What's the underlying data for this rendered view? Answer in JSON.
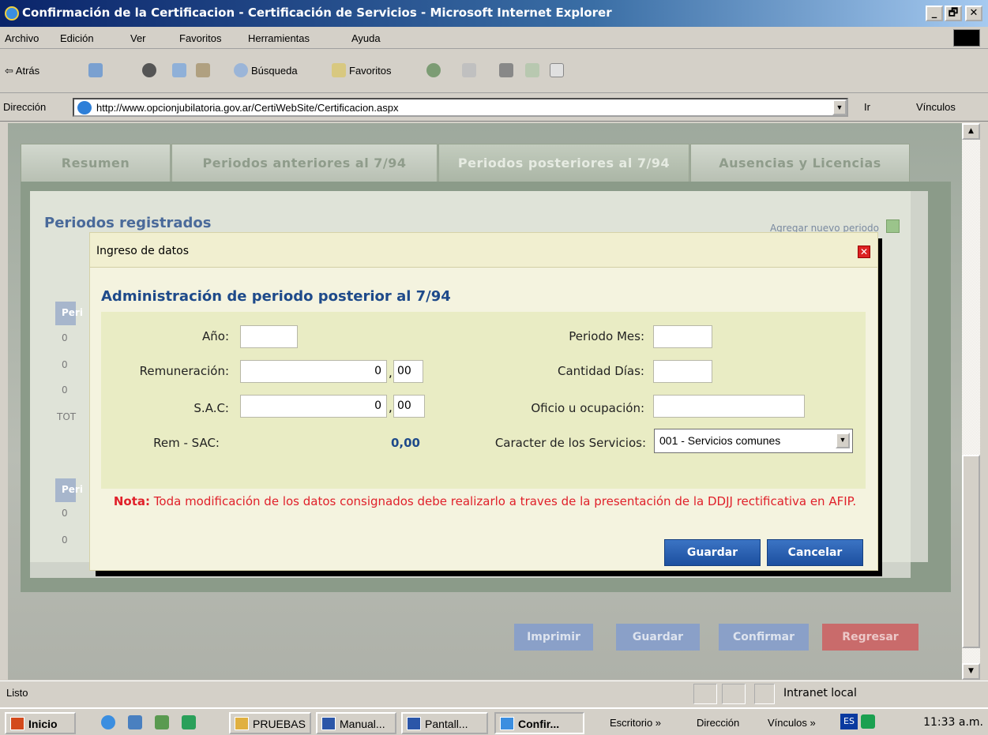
{
  "window": {
    "title": "Confirmación de la Certificacion - Certificación de Servicios - Microsoft Internet Explorer",
    "min": "_",
    "max": "🗗",
    "close": "✕"
  },
  "menu": [
    "Archivo",
    "Edición",
    "Ver",
    "Favoritos",
    "Herramientas",
    "Ayuda"
  ],
  "toolbar": {
    "back": "⇦ Atrás",
    "search": "Búsqueda",
    "favorites": "Favoritos"
  },
  "address": {
    "label": "Dirección",
    "url": "http://www.opcionjubilatoria.gov.ar/CertiWebSite/Certificacion.aspx",
    "go": "Ir",
    "links": "Vínculos"
  },
  "tabs": [
    "Resumen",
    "Periodos anteriores al 7/94",
    "Periodos posteriores al 7/94",
    "Ausencias y Licencias"
  ],
  "section": {
    "title": "Periodos registrados",
    "add": "Agregar nuevo periodo"
  },
  "grid_stub": [
    "Peri",
    "0",
    "0",
    "0",
    "TOT",
    "Peri",
    "0",
    "0"
  ],
  "page_buttons": [
    "Imprimir",
    "Guardar",
    "Confirmar",
    "Regresar"
  ],
  "modal": {
    "title": "Ingreso de datos",
    "close": "✕",
    "heading": "Administración de periodo posterior al 7/94",
    "fields": {
      "anio": {
        "label": "Año:",
        "value": ""
      },
      "remuneracion": {
        "label": "Remuneración:",
        "int": "0",
        "dec": "00"
      },
      "sac": {
        "label": "S.A.C:",
        "int": "0",
        "dec": "00"
      },
      "rem_sac": {
        "label": "Rem - SAC:",
        "value": "0,00"
      },
      "mes": {
        "label": "Periodo Mes:",
        "value": ""
      },
      "dias": {
        "label": "Cantidad Días:",
        "value": ""
      },
      "oficio": {
        "label": "Oficio u ocupación:",
        "value": ""
      },
      "caracter": {
        "label": "Caracter de los Servicios:",
        "value": "001 - Servicios comunes"
      }
    },
    "note_label": "Nota:",
    "note_text": "Toda modificación de los datos consignados debe realizarlo a traves de la presentación de la DDJJ rectificativa en AFIP.",
    "buttons": {
      "save": "Guardar",
      "cancel": "Cancelar"
    }
  },
  "status": {
    "text": "Listo",
    "zone": "Intranet local"
  },
  "taskbar": {
    "start": "Inicio",
    "items": [
      "PRUEBAS",
      "Manual...",
      "Pantall...",
      "Confir..."
    ],
    "escritorio": "Escritorio »",
    "direccion": "Dirección",
    "vinculos": "Vínculos »",
    "lang": "ES",
    "clock": "11:33 a.m."
  },
  "colors": {
    "modal_heading": "#1e4a8a",
    "note": "#e0202a",
    "button_blue": "#1c4f9f",
    "regresar": "#c96b6b"
  }
}
